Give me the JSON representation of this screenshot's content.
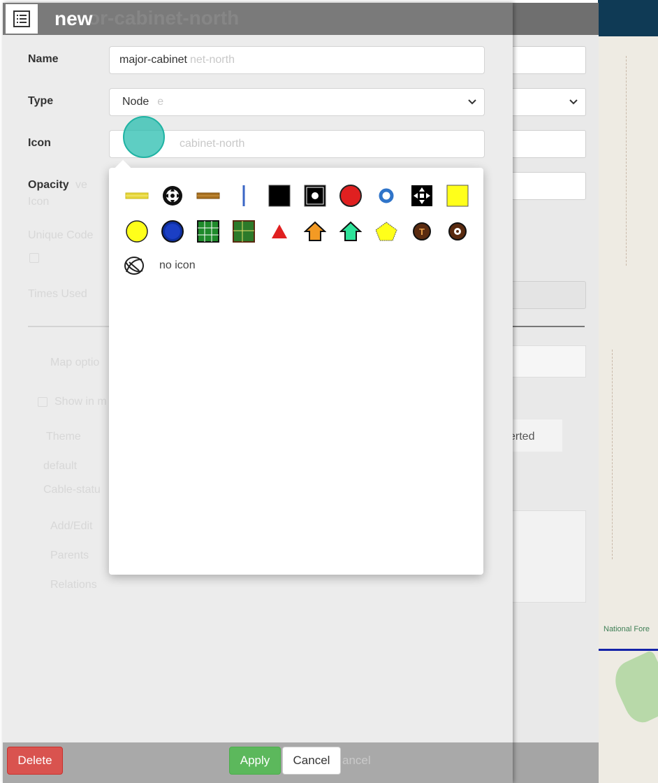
{
  "dialog": {
    "title": "new",
    "ghost_title": "or-cabinet-north"
  },
  "form": {
    "name_label": "Name",
    "name_value": "major-cabinet",
    "name_ghost": "net-north",
    "type_label": "Type",
    "type_value": "Node",
    "type_ghost": "e",
    "icon_label": "Icon",
    "icon_ghost": "cabinet-north",
    "opacity_label": "Opacity",
    "opacity_ghost": "ve",
    "opacity_ghost2": "Icon"
  },
  "background_faded": {
    "unique_code": "Unique Code",
    "times_used": "Times Used",
    "map_options": "Map optio",
    "show_in": "Show in m",
    "theme": "Theme",
    "default": "default",
    "cable_status": "Cable-statu",
    "add_edit": "Add/Edit",
    "parents": "Parents",
    "relations": "Relations",
    "inverted": "erted"
  },
  "icon_picker": {
    "row1": [
      "yellow-bar-icon",
      "crosshair-circle-icon",
      "brown-bar-icon",
      "blue-vertical-line-icon",
      "black-square-icon",
      "black-square-white-dot-icon",
      "red-circle-icon",
      "blue-ring-icon",
      "black-square-arrows-icon",
      "yellow-square-icon"
    ],
    "row2": [
      "yellow-circle-icon",
      "blue-circle-icon",
      "green-grid-icon",
      "green-grid-dark-icon",
      "red-triangle-icon",
      "orange-house-icon",
      "green-house-icon",
      "yellow-house-icon",
      "brown-circle-t-icon",
      "brown-circle-dot-icon"
    ],
    "no_icon_label": "no icon"
  },
  "footer": {
    "delete_label": "Delete",
    "apply_label": "Apply",
    "cancel_label": "Cancel",
    "ghost_cancel": "ancel"
  },
  "map": {
    "label": "National Fore"
  },
  "colors": {
    "header": "#7a7a7a",
    "apply": "#5cb85c",
    "delete": "#d9534f",
    "cursor": "#1fb3a3"
  }
}
